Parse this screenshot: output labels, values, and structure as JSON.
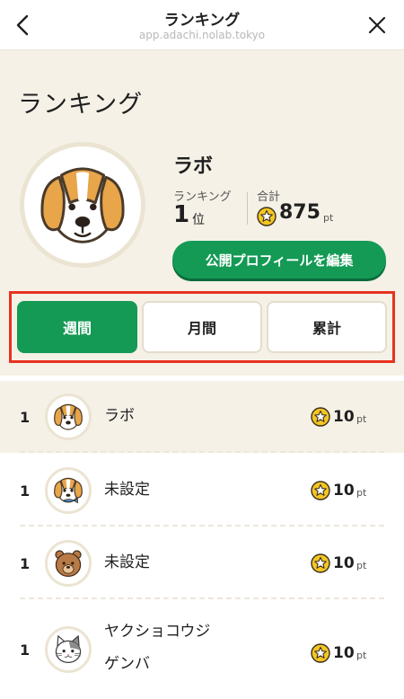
{
  "nav": {
    "title": "ランキング",
    "url": "app.adachi.nolab.tokyo",
    "back_icon": "chevron-left-icon",
    "close_icon": "close-icon"
  },
  "header": {
    "title": "ランキング",
    "user_name": "ラボ",
    "rank_label": "ランキング",
    "rank_value": "1",
    "rank_unit": "位",
    "total_label": "合計",
    "total_value": "875",
    "total_unit": "pt",
    "edit_button": "公開プロフィールを編集"
  },
  "tabs": [
    {
      "label": "週間",
      "active": true
    },
    {
      "label": "月間",
      "active": false
    },
    {
      "label": "累計",
      "active": false
    }
  ],
  "ranking": [
    {
      "rank": "1",
      "name": "ラボ",
      "avatar": "beagle-icon",
      "points": "10",
      "unit": "pt",
      "highlight": true
    },
    {
      "rank": "1",
      "name": "未設定",
      "avatar": "beagle-fish-icon",
      "points": "10",
      "unit": "pt",
      "highlight": false
    },
    {
      "rank": "1",
      "name": "未設定",
      "avatar": "bear-icon",
      "points": "10",
      "unit": "pt",
      "highlight": false
    },
    {
      "rank": "1",
      "name_line1": "ヤクショコウジ",
      "name_line2": "ゲンバ",
      "avatar": "cat-icon",
      "points": "10",
      "unit": "pt",
      "highlight": false
    }
  ],
  "colors": {
    "accent_green": "#149a55",
    "header_bg": "#f5f1e7",
    "highlight_frame": "#e8321f",
    "coin_yellow": "#f3c623"
  }
}
